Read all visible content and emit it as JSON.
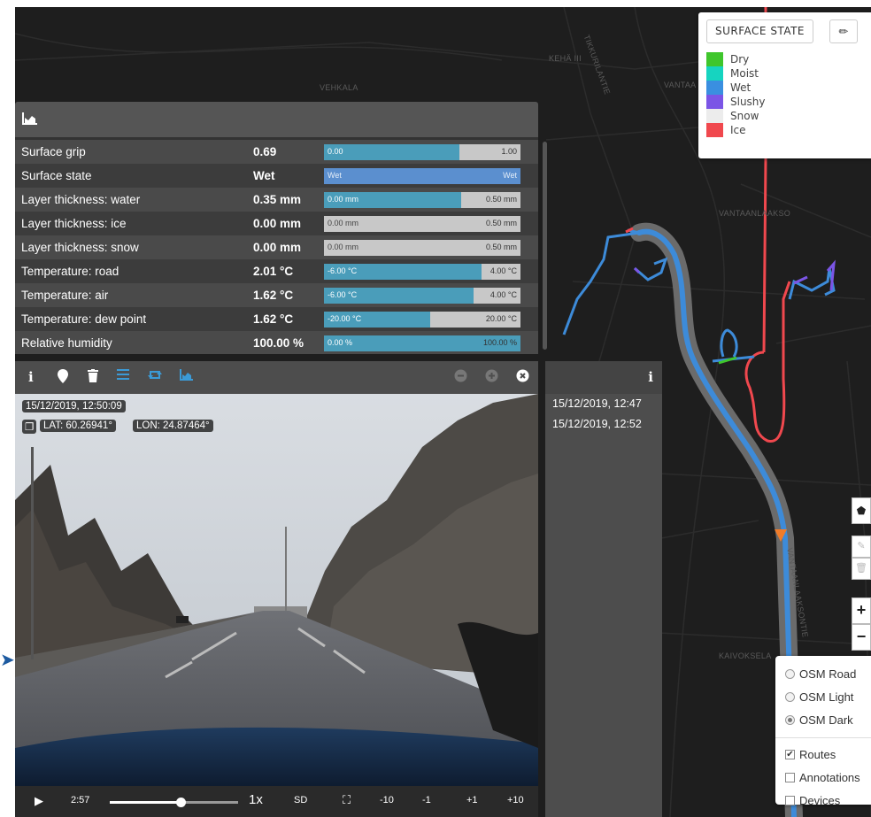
{
  "map": {
    "labels": [
      "VEHKALA",
      "KEHÄ III",
      "VANTAA",
      "VANTAANLAAKSO",
      "KAIVOKSELA",
      "VANTAANLAAKSONTIE",
      "TIKKURILANTIE"
    ]
  },
  "legend": {
    "button": "SURFACE STATE",
    "edit_icon": "pencil-icon",
    "items": [
      {
        "label": "Dry",
        "color": "#3fc62c"
      },
      {
        "label": "Moist",
        "color": "#16d4c0"
      },
      {
        "label": "Wet",
        "color": "#3a8fe0"
      },
      {
        "label": "Slushy",
        "color": "#7b55e6"
      },
      {
        "label": "Snow",
        "color": "#ececec"
      },
      {
        "label": "Ice",
        "color": "#f0484e"
      }
    ]
  },
  "data_panel": {
    "header_icon": "area-chart-icon",
    "rows": [
      {
        "label": "Surface grip",
        "value": "0.69",
        "min": "0.00",
        "max": "1.00",
        "fill": 0.69
      },
      {
        "label": "Surface state",
        "value": "Wet",
        "min": "Wet",
        "max": "Wet",
        "fill": 1.0
      },
      {
        "label": "Layer thickness: water",
        "value": "0.35 mm",
        "min": "0.00 mm",
        "max": "0.50 mm",
        "fill": 0.7
      },
      {
        "label": "Layer thickness: ice",
        "value": "0.00 mm",
        "min": "0.00 mm",
        "max": "0.50 mm",
        "fill": 0.0
      },
      {
        "label": "Layer thickness: snow",
        "value": "0.00 mm",
        "min": "0.00 mm",
        "max": "0.50 mm",
        "fill": 0.0
      },
      {
        "label": "Temperature: road",
        "value": "2.01 °C",
        "min": "-6.00 °C",
        "max": "4.00 °C",
        "fill": 0.8
      },
      {
        "label": "Temperature: air",
        "value": "1.62 °C",
        "min": "-6.00 °C",
        "max": "4.00 °C",
        "fill": 0.76
      },
      {
        "label": "Temperature: dew point",
        "value": "1.62 °C",
        "min": "-20.00 °C",
        "max": "20.00 °C",
        "fill": 0.54
      },
      {
        "label": "Relative humidity",
        "value": "100.00 %",
        "min": "0.00 %",
        "max": "100.00 %",
        "fill": 1.0
      }
    ]
  },
  "video": {
    "timestamp": "15/12/2019, 12:50:09",
    "lat": "LAT: 60.26941°",
    "lon": "LON: 24.87464°",
    "time": "2:57",
    "speed": "1x",
    "quality": "SD",
    "steps": [
      "-10",
      "-1",
      "+1",
      "+10"
    ],
    "progress": 0.55
  },
  "timeline": {
    "items": [
      "15/12/2019, 12:47",
      "15/12/2019, 12:52"
    ]
  },
  "map_controls": {
    "zoom_in": "+",
    "zoom_out": "−"
  },
  "layers": {
    "base": [
      {
        "label": "OSM Road",
        "selected": false
      },
      {
        "label": "OSM Light",
        "selected": false
      },
      {
        "label": "OSM Dark",
        "selected": true
      }
    ],
    "overlays": [
      {
        "label": "Routes",
        "checked": true
      },
      {
        "label": "Annotations",
        "checked": false
      },
      {
        "label": "Devices",
        "checked": false
      }
    ]
  }
}
